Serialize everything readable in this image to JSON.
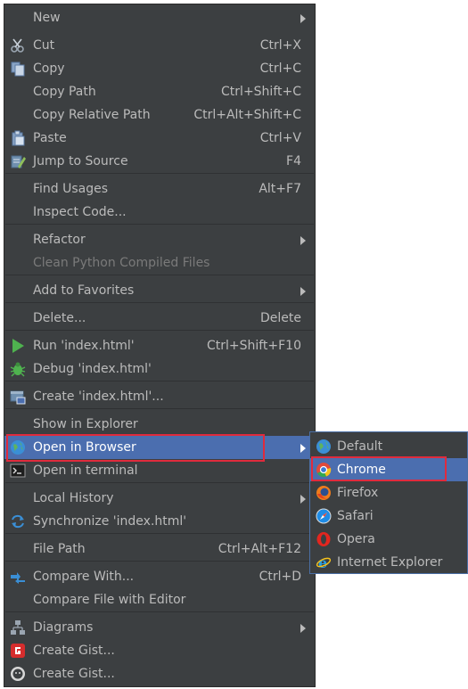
{
  "menu": {
    "items": [
      {
        "label": "New",
        "shortcut": "",
        "icon": "",
        "arrow": true
      },
      {
        "label": "Cut",
        "shortcut": "Ctrl+X",
        "icon": "scissors-icon"
      },
      {
        "label": "Copy",
        "shortcut": "Ctrl+C",
        "icon": "copy-icon"
      },
      {
        "label": "Copy Path",
        "shortcut": "Ctrl+Shift+C",
        "icon": ""
      },
      {
        "label": "Copy Relative Path",
        "shortcut": "Ctrl+Alt+Shift+C",
        "icon": ""
      },
      {
        "label": "Paste",
        "shortcut": "Ctrl+V",
        "icon": "clipboard-icon"
      },
      {
        "label": "Jump to Source",
        "shortcut": "F4",
        "icon": "edit-source-icon"
      },
      {
        "label": "Find Usages",
        "shortcut": "Alt+F7",
        "icon": ""
      },
      {
        "label": "Inspect Code...",
        "shortcut": "",
        "icon": ""
      },
      {
        "label": "Refactor",
        "shortcut": "",
        "icon": "",
        "arrow": true
      },
      {
        "label": "Clean Python Compiled Files",
        "shortcut": "",
        "icon": "",
        "disabled": true
      },
      {
        "label": "Add to Favorites",
        "shortcut": "",
        "icon": "",
        "arrow": true
      },
      {
        "label": "Delete...",
        "shortcut": "Delete",
        "icon": ""
      },
      {
        "label": "Run 'index.html'",
        "shortcut": "Ctrl+Shift+F10",
        "icon": "run-icon"
      },
      {
        "label": "Debug 'index.html'",
        "shortcut": "",
        "icon": "bug-icon"
      },
      {
        "label": "Create 'index.html'...",
        "shortcut": "",
        "icon": "run-config-icon"
      },
      {
        "label": "Show in Explorer",
        "shortcut": "",
        "icon": ""
      },
      {
        "label": "Open in Browser",
        "shortcut": "",
        "icon": "globe-icon",
        "arrow": true,
        "selected": true
      },
      {
        "label": "Open in terminal",
        "shortcut": "",
        "icon": "terminal-icon"
      },
      {
        "label": "Local History",
        "shortcut": "",
        "icon": "",
        "arrow": true
      },
      {
        "label": "Synchronize 'index.html'",
        "shortcut": "",
        "icon": "sync-icon"
      },
      {
        "label": "File Path",
        "shortcut": "Ctrl+Alt+F12",
        "icon": ""
      },
      {
        "label": "Compare With...",
        "shortcut": "Ctrl+D",
        "icon": "compare-icon"
      },
      {
        "label": "Compare File with Editor",
        "shortcut": "",
        "icon": ""
      },
      {
        "label": "Diagrams",
        "shortcut": "",
        "icon": "diagram-icon",
        "arrow": true
      },
      {
        "label": "Create Gist...",
        "shortcut": "",
        "icon": "gist-red-icon"
      },
      {
        "label": "Create Gist...",
        "shortcut": "",
        "icon": "github-octocat-icon"
      }
    ]
  },
  "submenu": {
    "items": [
      {
        "label": "Default",
        "icon": "globe-icon"
      },
      {
        "label": "Chrome",
        "icon": "chrome-icon",
        "selected": true
      },
      {
        "label": "Firefox",
        "icon": "firefox-icon"
      },
      {
        "label": "Safari",
        "icon": "safari-icon"
      },
      {
        "label": "Opera",
        "icon": "opera-icon"
      },
      {
        "label": "Internet Explorer",
        "icon": "ie-icon"
      }
    ]
  },
  "colors": {
    "menu_bg": "#3c3f41",
    "text": "#bbbbbb",
    "selection": "#4b6eaf",
    "highlight_box": "#e02b3d"
  }
}
